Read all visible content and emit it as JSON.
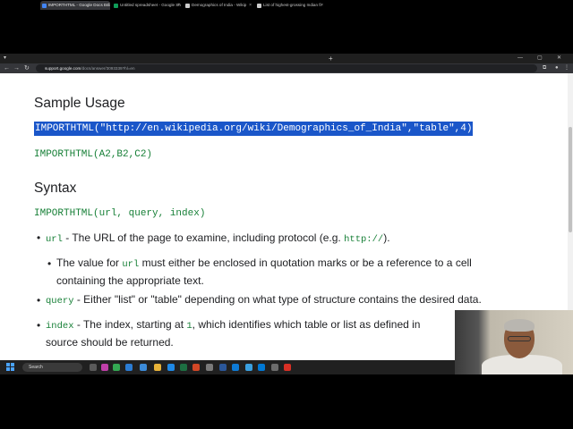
{
  "browser": {
    "tabs": [
      {
        "title": "IMPORTHTML - Google Docs Edi",
        "active": true,
        "favicon_color": "#4285f4"
      },
      {
        "title": "Untitled spreadsheet - Google Sh",
        "active": false,
        "favicon_color": "#0f9d58"
      },
      {
        "title": "Demographics of India - Wikip",
        "active": false,
        "favicon_color": "#cccccc"
      },
      {
        "title": "List of highest-grossing Indian fi",
        "active": false,
        "favicon_color": "#cccccc"
      }
    ],
    "new_tab": "+",
    "url_domain": "support.google.com",
    "url_path": "/docs/answer/3093339?hl=en"
  },
  "page": {
    "sample_usage_heading": "Sample Usage",
    "example1": "IMPORTHTML(\"http://en.wikipedia.org/wiki/Demographics_of_India\",\"table\",4)",
    "example2": "IMPORTHTML(A2,B2,C2)",
    "syntax_heading": "Syntax",
    "syntax": "IMPORTHTML(url, query, index)",
    "params": {
      "url_name": "url",
      "url_desc_1": " - The URL of the page to examine, including protocol (e.g. ",
      "url_example": "http://",
      "url_desc_2": ").",
      "url_sub_1": "The value for ",
      "url_sub_code": "url",
      "url_sub_2": " must either be enclosed in quotation marks or be a reference to a cell",
      "url_sub_3": "containing the appropriate text.",
      "query_name": "query",
      "query_desc": " - Either \"list\" or \"table\" depending on what type of structure contains the desired data.",
      "index_name": "index",
      "index_desc_1": " - The index, starting at ",
      "index_one": "1",
      "index_desc_2": ", which identifies which table or list as defined in",
      "index_desc_3": "source should be returned."
    }
  },
  "taskbar": {
    "search_label": "Search"
  },
  "colors": {
    "code_green": "#188038",
    "selection_blue": "#1a56c9",
    "text": "#202124"
  }
}
